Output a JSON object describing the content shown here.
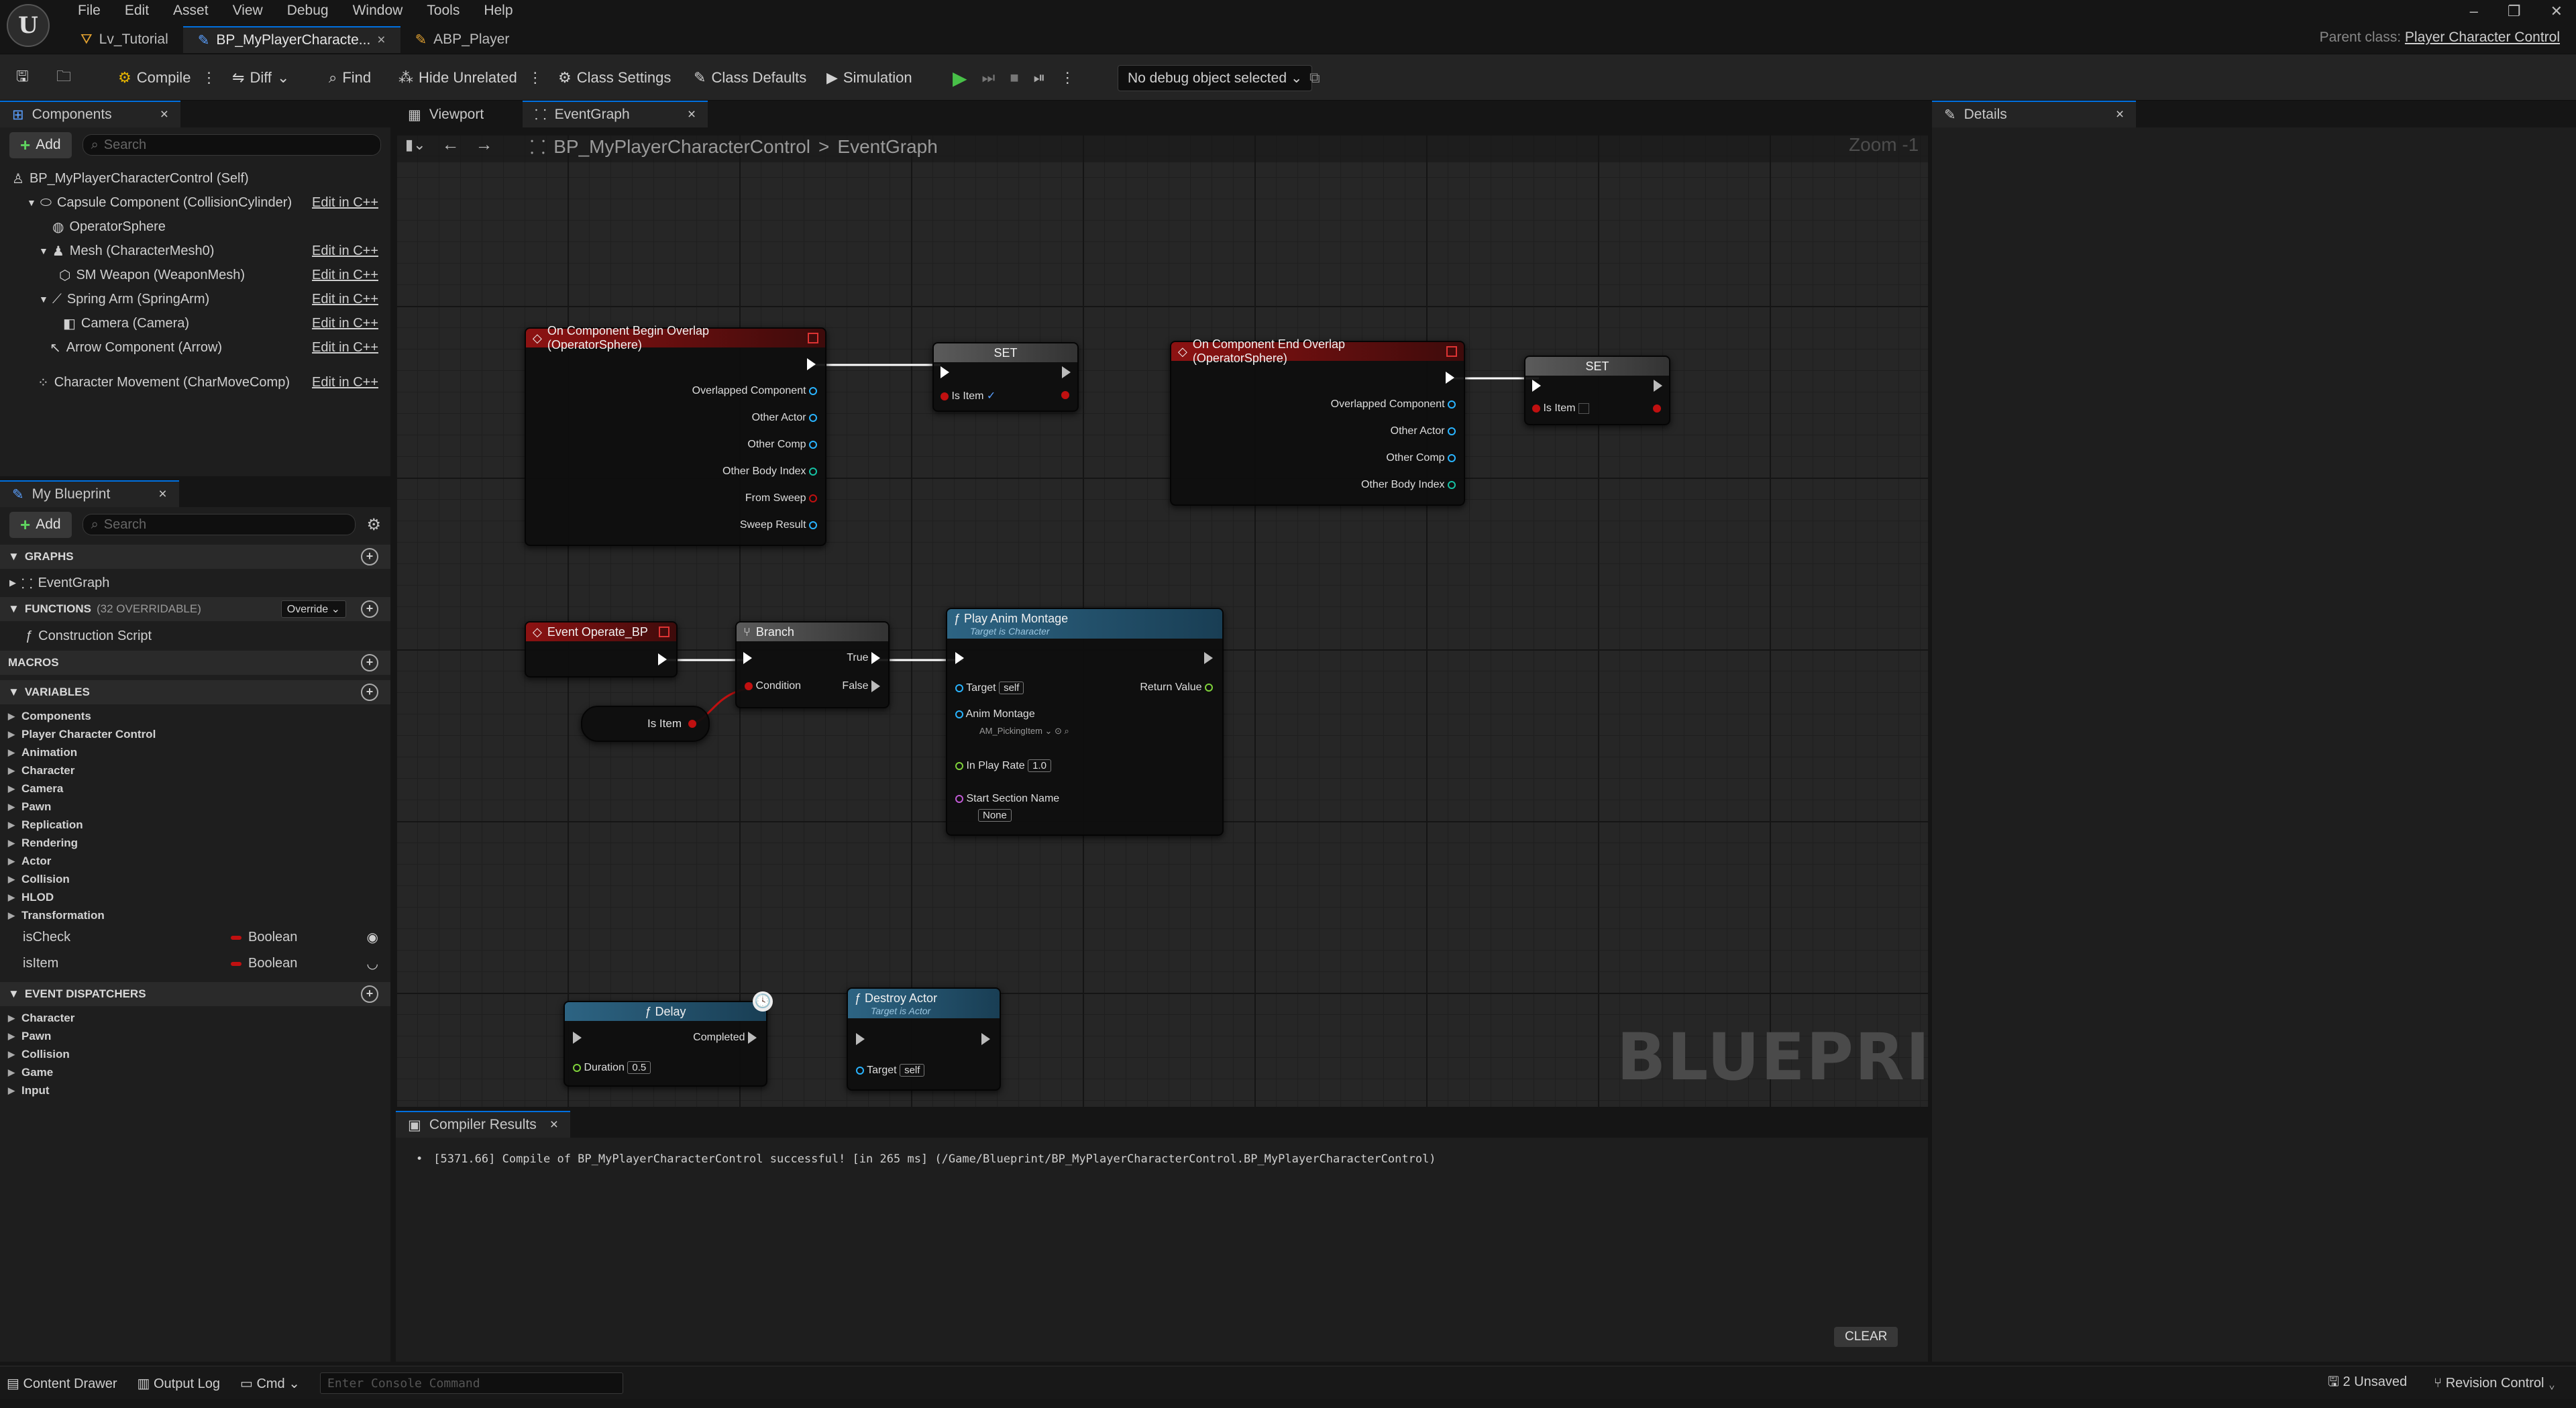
{
  "menu": [
    "File",
    "Edit",
    "Asset",
    "View",
    "Debug",
    "Window",
    "Tools",
    "Help"
  ],
  "doc_tabs": [
    {
      "label": "Lv_Tutorial"
    },
    {
      "label": "BP_MyPlayerCharacte..."
    },
    {
      "label": "ABP_Player"
    }
  ],
  "parent_class": {
    "label": "Parent class:",
    "value": "Player Character Control"
  },
  "toolbar": {
    "compile": "Compile",
    "diff": "Diff",
    "find": "Find",
    "hide_unrelated": "Hide Unrelated",
    "class_settings": "Class Settings",
    "class_defaults": "Class Defaults",
    "simulation": "Simulation",
    "debug_object": "No debug object selected"
  },
  "components": {
    "tab": "Components",
    "add": "Add",
    "search_placeholder": "Search",
    "items": [
      {
        "label": "BP_MyPlayerCharacterControl (Self)",
        "edit": ""
      },
      {
        "label": "Capsule Component (CollisionCylinder)",
        "edit": "Edit in C++"
      },
      {
        "label": "OperatorSphere",
        "edit": ""
      },
      {
        "label": "Mesh (CharacterMesh0)",
        "edit": "Edit in C++"
      },
      {
        "label": "SM Weapon (WeaponMesh)",
        "edit": "Edit in C++"
      },
      {
        "label": "Spring Arm (SpringArm)",
        "edit": "Edit in C++"
      },
      {
        "label": "Camera (Camera)",
        "edit": "Edit in C++"
      },
      {
        "label": "Arrow Component (Arrow)",
        "edit": "Edit in C++"
      },
      {
        "label": "Character Movement (CharMoveComp)",
        "edit": "Edit in C++"
      }
    ]
  },
  "my_blueprint": {
    "tab": "My Blueprint",
    "add": "Add",
    "search_placeholder": "Search",
    "graphs_label": "GRAPHS",
    "graph_item": "EventGraph",
    "functions_label": "FUNCTIONS",
    "functions_count": "(32 OVERRIDABLE)",
    "override": "Override",
    "construction_script": "Construction Script",
    "macros_label": "MACROS",
    "variables_label": "VARIABLES",
    "variable_categories": [
      "Components",
      "Player Character Control",
      "Animation",
      "Character",
      "Camera",
      "Pawn",
      "Replication",
      "Rendering",
      "Actor",
      "Collision",
      "HLOD",
      "Transformation"
    ],
    "variables": [
      {
        "name": "isCheck",
        "type": "Boolean"
      },
      {
        "name": "isItem",
        "type": "Boolean"
      }
    ],
    "dispatchers_label": "EVENT DISPATCHERS",
    "dispatcher_categories": [
      "Character",
      "Pawn",
      "Collision",
      "Game",
      "Input"
    ]
  },
  "editor_tabs": [
    {
      "label": "Viewport"
    },
    {
      "label": "EventGraph"
    }
  ],
  "graph": {
    "breadcrumb_root": "BP_MyPlayerCharacterControl",
    "breadcrumb_sep": ">",
    "breadcrumb_leaf": "EventGraph",
    "zoom": "Zoom -1",
    "watermark": "BLUEPRINT",
    "nodes": {
      "begin_overlap": {
        "title": "On Component Begin Overlap (OperatorSphere)",
        "pins": [
          "Overlapped Component",
          "Other Actor",
          "Other Comp",
          "Other Body Index",
          "From Sweep",
          "Sweep Result"
        ]
      },
      "set1": {
        "title": "SET",
        "pin": "Is Item",
        "check": "✓"
      },
      "end_overlap": {
        "title": "On Component End Overlap (OperatorSphere)",
        "pins": [
          "Overlapped Component",
          "Other Actor",
          "Other Comp",
          "Other Body Index"
        ]
      },
      "set2": {
        "title": "SET",
        "pin": "Is Item"
      },
      "event_operate": {
        "title": "Event Operate_BP"
      },
      "branch": {
        "title": "Branch",
        "condition": "Condition",
        "true": "True",
        "false": "False"
      },
      "is_item_getter": {
        "label": "Is Item"
      },
      "play_anim": {
        "title": "Play Anim Montage",
        "subtitle": "Target is Character",
        "target": "Target",
        "target_val": "self",
        "return": "Return Value",
        "montage": "Anim Montage",
        "montage_val": "AM_PickingItem",
        "rate": "In Play Rate",
        "rate_val": "1.0",
        "section": "Start Section Name",
        "section_val": "None"
      },
      "delay": {
        "title": "Delay",
        "completed": "Completed",
        "duration": "Duration",
        "duration_val": "0.5"
      },
      "destroy": {
        "title": "Destroy Actor",
        "subtitle": "Target is Actor",
        "target": "Target",
        "target_val": "self"
      }
    }
  },
  "compiler": {
    "tab": "Compiler Results",
    "message": "[5371.66] Compile of BP_MyPlayerCharacterControl successful! [in 265 ms] (/Game/Blueprint/BP_MyPlayerCharacterControl.BP_MyPlayerCharacterControl)",
    "clear": "CLEAR"
  },
  "details": {
    "tab": "Details"
  },
  "statusbar": {
    "content_drawer": "Content Drawer",
    "output_log": "Output Log",
    "cmd": "Cmd",
    "console_placeholder": "Enter Console Command",
    "unsaved": "2 Unsaved",
    "revision": "Revision Control"
  },
  "colors": {
    "accent": "#0070e0",
    "event_red": "#8d1212",
    "function_blue": "#2d6483",
    "boolean_red": "#c01010"
  }
}
